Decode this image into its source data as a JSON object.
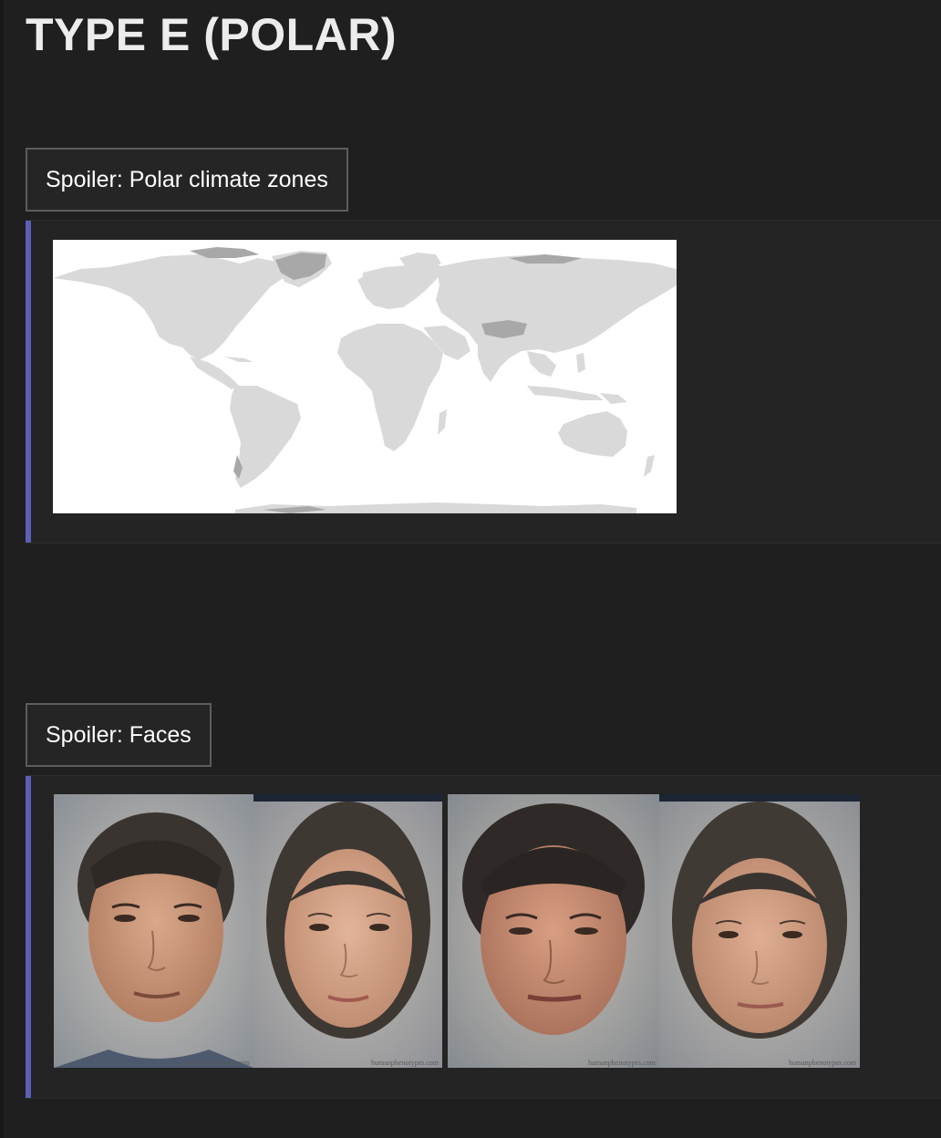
{
  "page": {
    "title": "TYPE E (POLAR)"
  },
  "spoilers": [
    {
      "label": "Spoiler: Polar climate zones",
      "image": "world-map"
    },
    {
      "label": "Spoiler: Faces",
      "image": "faces-row",
      "watermarks": [
        "humanphenotypes.com",
        "humanphenotypes.com",
        "humanphenotypes.com",
        "humanphenotypes.com"
      ]
    }
  ],
  "colors": {
    "background": "#1f1f1f",
    "accent_bar": "#5b60b8",
    "button_border": "#5d5d5d",
    "map_land": "#d9d9d9",
    "map_water": "#ffffff"
  },
  "icons": {}
}
